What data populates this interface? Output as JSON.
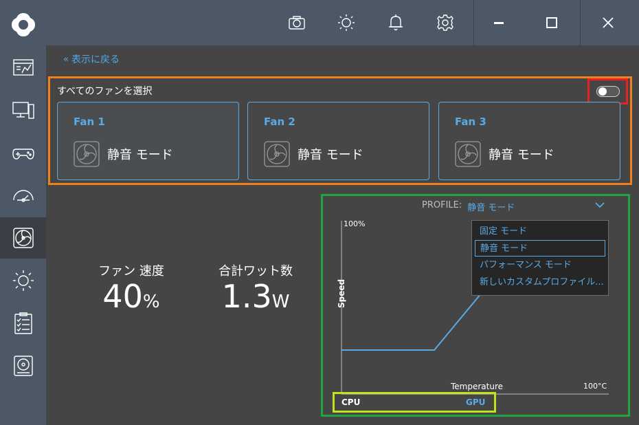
{
  "titlebar": {
    "buttons": [
      "screenshot",
      "display",
      "notifications",
      "settings",
      "minimize",
      "maximize",
      "close"
    ]
  },
  "sidebar": {
    "items": [
      {
        "name": "dashboard",
        "active": false
      },
      {
        "name": "system-info",
        "active": false
      },
      {
        "name": "game-mode",
        "active": false
      },
      {
        "name": "overclock",
        "active": false
      },
      {
        "name": "fan-control",
        "active": true
      },
      {
        "name": "lighting",
        "active": false
      },
      {
        "name": "checklist",
        "active": false
      },
      {
        "name": "storage",
        "active": false
      }
    ]
  },
  "back": {
    "label": "表示に戻る"
  },
  "fans": {
    "select_all_label": "すべてのファンを選択",
    "select_all_on": false,
    "cards": [
      {
        "name": "Fan 1",
        "mode": "静音 モード"
      },
      {
        "name": "Fan 2",
        "mode": "静音 モード"
      },
      {
        "name": "Fan 3",
        "mode": "静音 モード"
      }
    ]
  },
  "stats": {
    "fan_speed": {
      "label": "ファン 速度",
      "value": "40",
      "unit": "%"
    },
    "total_watts": {
      "label": "合計ワット数",
      "value": "1.3",
      "unit": "W"
    }
  },
  "graph": {
    "profile_label": "PROFILE:",
    "profile_value": "静音 モード",
    "y_max_label": "100%",
    "y_axis_label": "Speed",
    "x_axis_label": "Temperature",
    "x_max_label": "100°C",
    "curve_color": "#5aaae6",
    "dropdown_options": [
      {
        "label": "固定 モード",
        "selected": false
      },
      {
        "label": "静音 モード",
        "selected": true
      },
      {
        "label": "パフォーマンス モード",
        "selected": false
      },
      {
        "label": "新しいカスタムプロファイル...",
        "selected": false
      }
    ],
    "source": {
      "cpu": "CPU",
      "gpu": "GPU",
      "active": "GPU"
    }
  },
  "colors": {
    "accent": "#5aaae6",
    "sidebar": "#4d5866",
    "background": "#454545"
  }
}
